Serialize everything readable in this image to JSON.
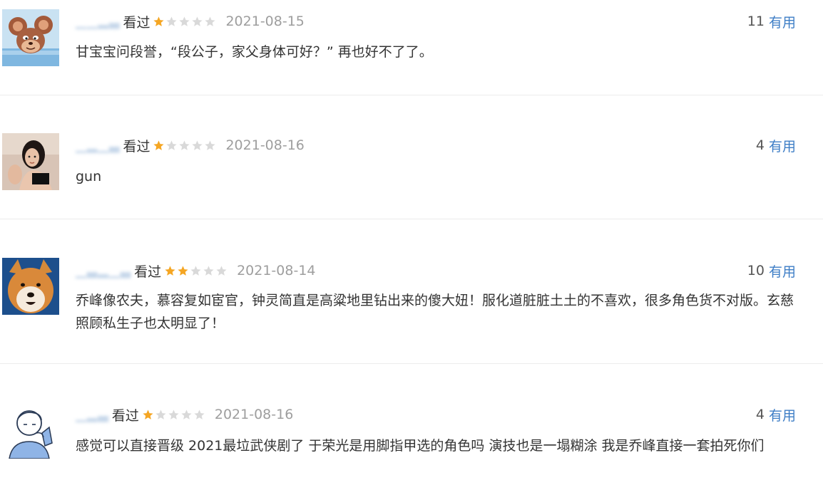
{
  "reviews": [
    {
      "status": "看过",
      "rating": 1,
      "max_rating": 5,
      "date": "2021-08-15",
      "useful_count": "11",
      "useful_label": "有用",
      "content": "甘宝宝问段誉，“段公子，家父身体可好？” 再也好不了了。",
      "avatar_icon": "cartoon-mouse-avatar"
    },
    {
      "status": "看过",
      "rating": 1,
      "max_rating": 5,
      "date": "2021-08-16",
      "useful_count": "4",
      "useful_label": "有用",
      "content": "gun",
      "avatar_icon": "woman-photo-avatar"
    },
    {
      "status": "看过",
      "rating": 2,
      "max_rating": 5,
      "date": "2021-08-14",
      "useful_count": "10",
      "useful_label": "有用",
      "content": "乔峰像农夫，慕容复如宦官，钟灵简直是高粱地里钻出来的傻大妞！服化道脏脏土土的不喜欢，很多角色货不对版。玄慈照顾私生子也太明显了！",
      "avatar_icon": "shiba-dog-avatar"
    },
    {
      "status": "看过",
      "rating": 1,
      "max_rating": 5,
      "date": "2021-08-16",
      "useful_count": "4",
      "useful_label": "有用",
      "content": "感觉可以直接晋级 2021最垃武侠剧了 于荣光是用脚指甲选的角色吗 演技也是一塌糊涂 我是乔峰直接一套拍死你们",
      "avatar_icon": "sketch-person-avatar"
    }
  ],
  "colors": {
    "star_filled": "#f5a623",
    "star_empty": "#d9d9d9",
    "useful_link": "#3e7ec6",
    "date": "#9e9e9e",
    "divider": "#ececec"
  }
}
